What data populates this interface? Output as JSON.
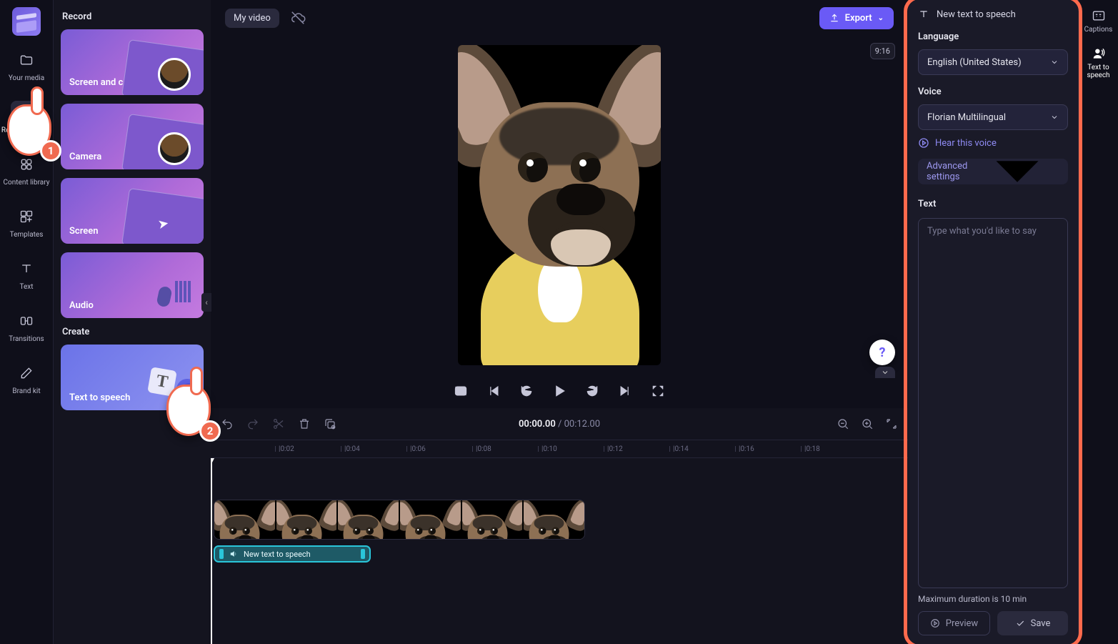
{
  "rail": {
    "items": [
      {
        "label": "Your media"
      },
      {
        "label": "Record & create"
      },
      {
        "label": "Content library"
      },
      {
        "label": "Templates"
      },
      {
        "label": "Text"
      },
      {
        "label": "Transitions"
      },
      {
        "label": "Brand kit"
      }
    ]
  },
  "panel": {
    "sections": {
      "record_title": "Record",
      "create_title": "Create"
    },
    "cards": {
      "screen_camera": "Screen and camera",
      "camera": "Camera",
      "screen": "Screen",
      "audio": "Audio",
      "tts": "Text to speech"
    }
  },
  "header": {
    "project_name": "My video",
    "export_label": "Export"
  },
  "preview": {
    "aspect_badge": "9:16",
    "help": "?",
    "time_current": "00:00.00",
    "time_total": "00:12.00"
  },
  "ruler_ticks": [
    "|0:02",
    "|0:04",
    "|0:06",
    "|0:08",
    "|0:10",
    "|0:12",
    "|0:14",
    "|0:16",
    "|0:18"
  ],
  "timeline": {
    "tts_clip_label": "New text to speech"
  },
  "right_rail": {
    "captions": "Captions",
    "tts": "Text to speech"
  },
  "tts": {
    "title": "New text to speech",
    "language_label": "Language",
    "language_value": "English (United States)",
    "voice_label": "Voice",
    "voice_value": "Florian Multilingual",
    "hear_voice": "Hear this voice",
    "advanced": "Advanced settings",
    "text_label": "Text",
    "text_placeholder": "Type what you'd like to say",
    "max_note": "Maximum duration is 10 min",
    "preview_btn": "Preview",
    "save_btn": "Save"
  },
  "annotations": {
    "step1": "1",
    "step2": "2"
  }
}
